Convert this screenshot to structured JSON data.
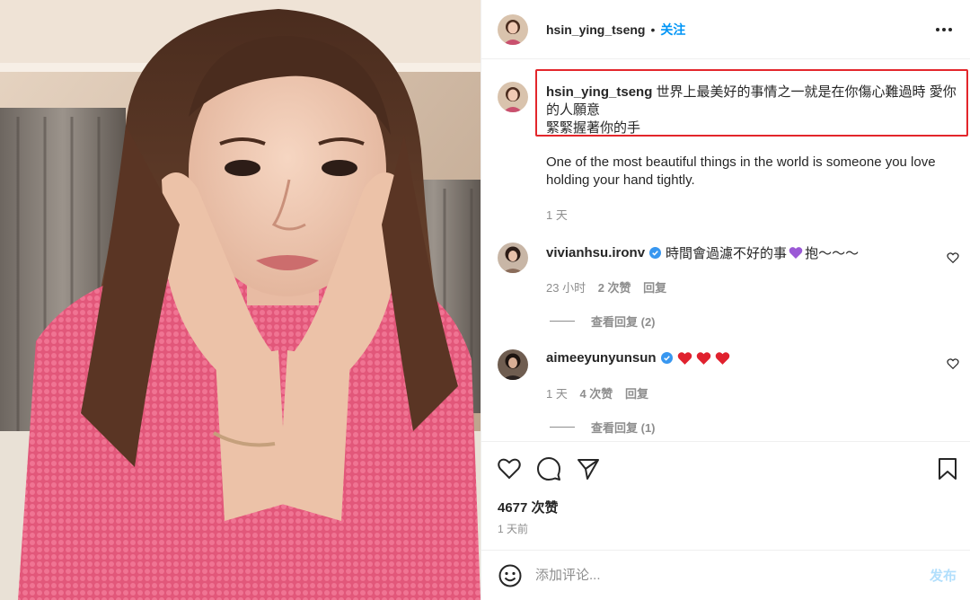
{
  "header": {
    "username": "hsin_ying_tseng",
    "separator": "•",
    "follow_label": "关注"
  },
  "caption": {
    "username": "hsin_ying_tseng",
    "text_line1": "世界上最美好的事情之一就是在你傷心難過時 愛你的人願意",
    "text_line2": "緊緊握著你的手",
    "translation": "One of the most beautiful things in the world is someone you love holding your hand tightly.",
    "age": "1 天"
  },
  "comments": [
    {
      "username": "vivianhsu.ironv",
      "verified": true,
      "text": "時間會過濾不好的事",
      "emoji": "purple-heart",
      "text_after": "抱～～～",
      "age": "23 小时",
      "likes": "2 次赞",
      "reply_label": "回复",
      "view_replies": "查看回复 (2)"
    },
    {
      "username": "aimeeyunyunsun",
      "verified": true,
      "text": "",
      "emoji": "red-heart-x3",
      "age": "1 天",
      "likes": "4 次赞",
      "reply_label": "回复",
      "view_replies": "查看回复 (1)"
    }
  ],
  "post": {
    "likes": "4677 次赞",
    "time": "1 天前"
  },
  "add_comment": {
    "placeholder": "添加评论...",
    "post_label": "发布"
  },
  "colors": {
    "accent": "#0095f6",
    "highlight_box": "#e3262b",
    "muted": "#8e8e8e",
    "post_disabled": "#b2dffc"
  },
  "icons": [
    "more-options-icon",
    "heart-icon",
    "comment-icon",
    "share-icon",
    "bookmark-icon",
    "emoji-icon",
    "verified-icon"
  ]
}
